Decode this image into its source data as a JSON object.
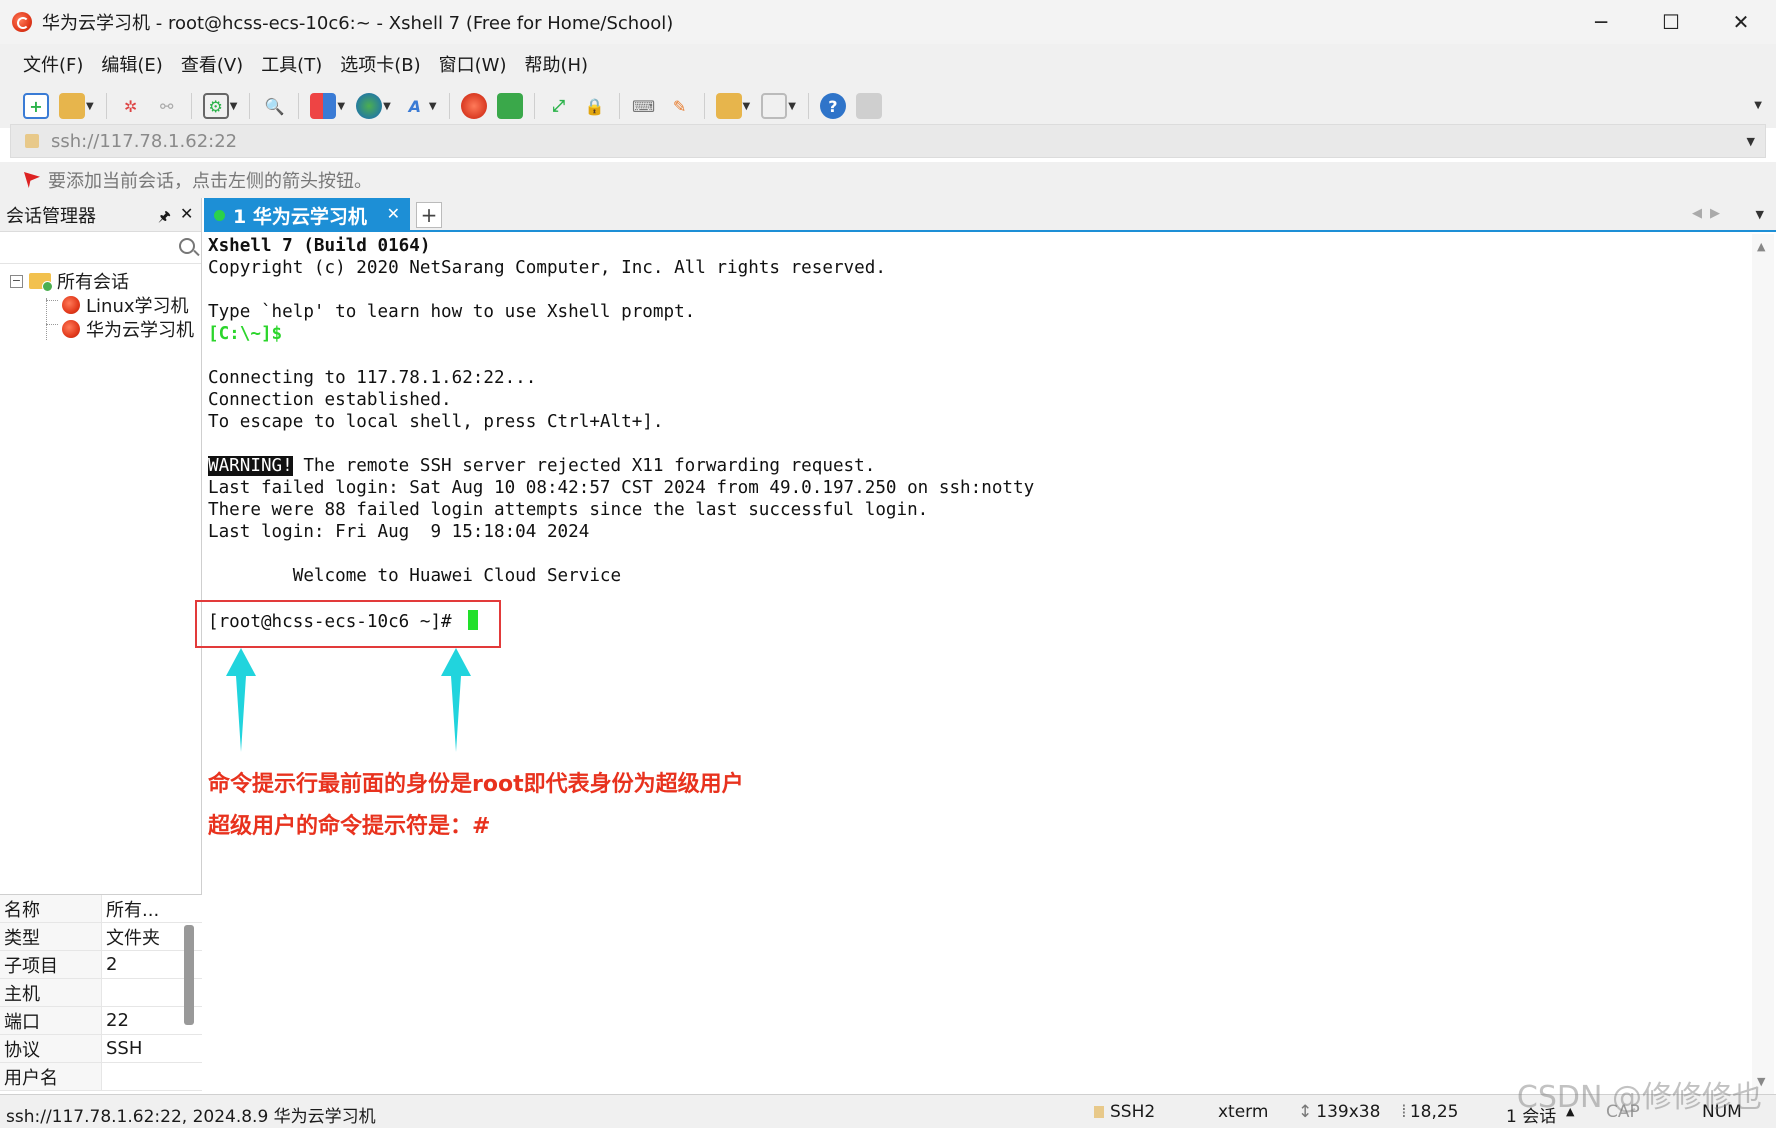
{
  "window": {
    "title": "华为云学习机 - root@hcss-ecs-10c6:~ - Xshell 7 (Free for Home/School)",
    "minimize": "─",
    "maximize": "☐",
    "close": "✕"
  },
  "menu": [
    "文件(F)",
    "编辑(E)",
    "查看(V)",
    "工具(T)",
    "选项卡(B)",
    "窗口(W)",
    "帮助(H)"
  ],
  "address": {
    "value": "ssh://117.78.1.62:22"
  },
  "hint": {
    "text": "要添加当前会话，点击左侧的箭头按钮。"
  },
  "session_manager": {
    "title": "会话管理器",
    "pin": "🖈",
    "close": "✕",
    "tree": {
      "root_toggle": "−",
      "root": "所有会话",
      "children": [
        "Linux学习机",
        "华为云学习机"
      ]
    },
    "properties": [
      {
        "key": "名称",
        "value": "所有..."
      },
      {
        "key": "类型",
        "value": "文件夹"
      },
      {
        "key": "子项目",
        "value": "2"
      },
      {
        "key": "主机",
        "value": ""
      },
      {
        "key": "端口",
        "value": "22"
      },
      {
        "key": "协议",
        "value": "SSH"
      },
      {
        "key": "用户名",
        "value": ""
      }
    ]
  },
  "tabs": {
    "active": "1 华为云学习机",
    "close": "✕",
    "add": "+"
  },
  "terminal": {
    "lines": [
      "Xshell 7 (Build 0164)",
      "Copyright (c) 2020 NetSarang Computer, Inc. All rights reserved.",
      "",
      "Type `help' to learn how to use Xshell prompt.",
      "[C:\\~]$",
      "",
      "Connecting to 117.78.1.62:22...",
      "Connection established.",
      "To escape to local shell, press Ctrl+Alt+].",
      "",
      "WARNING!",
      " The remote SSH server rejected X11 forwarding request.",
      "Last failed login: Sat Aug 10 08:42:57 CST 2024 from 49.0.197.250 on ssh:notty",
      "There were 88 failed login attempts since the last successful login.",
      "Last login: Fri Aug  9 15:18:04 2024",
      "",
      "        Welcome to Huawei Cloud Service",
      "",
      "[root@hcss-ecs-10c6 ~]# "
    ],
    "cursor_color": "#22e02a",
    "warning_bg": "#111111",
    "prompt_local_color": "#2cd52c"
  },
  "annotation": {
    "box_color": "#e23a3a",
    "arrow_color": "#21d4dd",
    "note_color": "#e8321e",
    "note_lines": [
      "命令提示行最前面的身份是root即代表身份为超级用户",
      "超级用户的命令提示符是：#"
    ]
  },
  "statusbar": {
    "left": "ssh://117.78.1.62:22, 2024.8.9 华为云学习机",
    "protocol": "SSH2",
    "terminal_type": "xterm",
    "size": "139x38",
    "cursor_pos": "18,25",
    "sessions": "1 会话",
    "caps": "CAP",
    "num": "NUM"
  },
  "watermark": "CSDN @修修修也",
  "colors": {
    "accent": "#1d8fd6",
    "tab_dot": "#2bd14a"
  }
}
